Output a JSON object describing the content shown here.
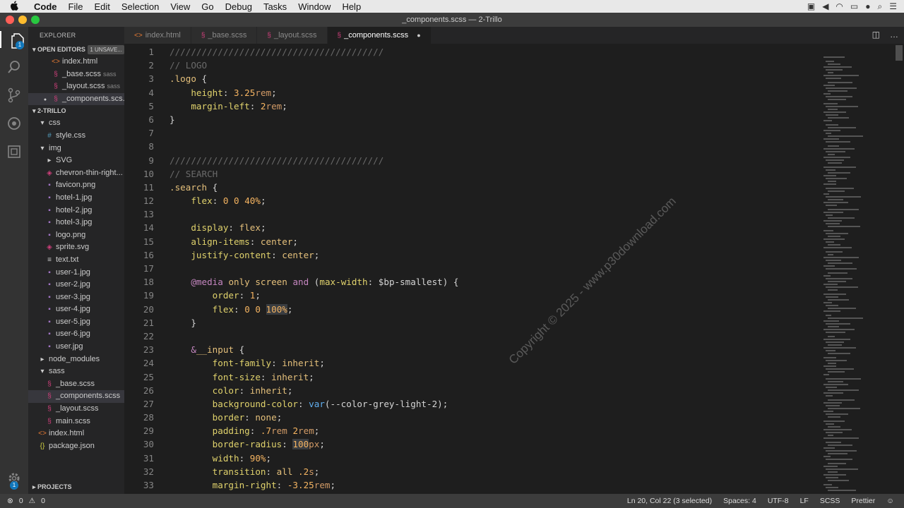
{
  "menubar": {
    "apple": "",
    "items": [
      "Code",
      "File",
      "Edit",
      "Selection",
      "View",
      "Go",
      "Debug",
      "Tasks",
      "Window",
      "Help"
    ]
  },
  "window": {
    "title": "_components.scss — 2-Trillo"
  },
  "activity": {
    "explorer_badge": "1",
    "settings_badge": "1"
  },
  "sidebar": {
    "title": "EXPLORER",
    "open_editors_label": "OPEN EDITORS",
    "unsaved_badge": "1 UNSAVE...",
    "open_editors": [
      {
        "name": "index.html",
        "sub": "",
        "icon": "<>"
      },
      {
        "name": "_base.scss",
        "sub": "sass",
        "icon": "S"
      },
      {
        "name": "_layout.scss",
        "sub": "sass",
        "icon": "S"
      },
      {
        "name": "_components.scs...",
        "sub": "",
        "icon": "S"
      }
    ],
    "project_label": "2-TRILLO",
    "tree": [
      {
        "name": "css",
        "indent": 1,
        "type": "folder-open"
      },
      {
        "name": "style.css",
        "indent": 2,
        "type": "css"
      },
      {
        "name": "img",
        "indent": 1,
        "type": "folder-open"
      },
      {
        "name": "SVG",
        "indent": 2,
        "type": "folder"
      },
      {
        "name": "chevron-thin-right...",
        "indent": 2,
        "type": "svg"
      },
      {
        "name": "favicon.png",
        "indent": 2,
        "type": "img"
      },
      {
        "name": "hotel-1.jpg",
        "indent": 2,
        "type": "img"
      },
      {
        "name": "hotel-2.jpg",
        "indent": 2,
        "type": "img"
      },
      {
        "name": "hotel-3.jpg",
        "indent": 2,
        "type": "img"
      },
      {
        "name": "logo.png",
        "indent": 2,
        "type": "img"
      },
      {
        "name": "sprite.svg",
        "indent": 2,
        "type": "svg"
      },
      {
        "name": "text.txt",
        "indent": 2,
        "type": "txt"
      },
      {
        "name": "user-1.jpg",
        "indent": 2,
        "type": "img"
      },
      {
        "name": "user-2.jpg",
        "indent": 2,
        "type": "img"
      },
      {
        "name": "user-3.jpg",
        "indent": 2,
        "type": "img"
      },
      {
        "name": "user-4.jpg",
        "indent": 2,
        "type": "img"
      },
      {
        "name": "user-5.jpg",
        "indent": 2,
        "type": "img"
      },
      {
        "name": "user-6.jpg",
        "indent": 2,
        "type": "img"
      },
      {
        "name": "user.jpg",
        "indent": 2,
        "type": "img"
      },
      {
        "name": "node_modules",
        "indent": 1,
        "type": "folder"
      },
      {
        "name": "sass",
        "indent": 1,
        "type": "folder-open"
      },
      {
        "name": "_base.scss",
        "indent": 2,
        "type": "scss"
      },
      {
        "name": "_components.scss",
        "indent": 2,
        "type": "scss",
        "selected": true
      },
      {
        "name": "_layout.scss",
        "indent": 2,
        "type": "scss"
      },
      {
        "name": "main.scss",
        "indent": 2,
        "type": "scss"
      },
      {
        "name": "index.html",
        "indent": 1,
        "type": "html"
      },
      {
        "name": "package.json",
        "indent": 1,
        "type": "json"
      }
    ],
    "projects_label": "PROJECTS"
  },
  "tabs": [
    {
      "label": "index.html",
      "icon": "<>",
      "active": false,
      "dirty": false
    },
    {
      "label": "_base.scss",
      "icon": "S",
      "active": false,
      "dirty": false
    },
    {
      "label": "_layout.scss",
      "icon": "S",
      "active": false,
      "dirty": false
    },
    {
      "label": "_components.scss",
      "icon": "S",
      "active": true,
      "dirty": true
    }
  ],
  "code": {
    "lines": [
      [
        [
          "c-com",
          "////////////////////////////////////////"
        ]
      ],
      [
        [
          "c-com",
          "// LOGO"
        ]
      ],
      [
        [
          "c-sel",
          ".logo"
        ],
        [
          "c-punc",
          " {"
        ]
      ],
      [
        [
          "c-punc",
          "    "
        ],
        [
          "c-prop",
          "height"
        ],
        [
          "c-punc",
          ": "
        ],
        [
          "c-num",
          "3.25"
        ],
        [
          "c-unit",
          "rem"
        ],
        [
          "c-punc",
          ";"
        ]
      ],
      [
        [
          "c-punc",
          "    "
        ],
        [
          "c-prop",
          "margin-left"
        ],
        [
          "c-punc",
          ": "
        ],
        [
          "c-num",
          "2"
        ],
        [
          "c-unit",
          "rem"
        ],
        [
          "c-punc",
          ";"
        ]
      ],
      [
        [
          "c-punc",
          "}"
        ]
      ],
      [],
      [],
      [
        [
          "c-com",
          "////////////////////////////////////////"
        ]
      ],
      [
        [
          "c-com",
          "// SEARCH"
        ]
      ],
      [
        [
          "c-sel",
          ".search"
        ],
        [
          "c-punc",
          " {"
        ]
      ],
      [
        [
          "c-punc",
          "    "
        ],
        [
          "c-prop",
          "flex"
        ],
        [
          "c-punc",
          ": "
        ],
        [
          "c-num",
          "0 0 40%"
        ],
        [
          "c-punc",
          ";"
        ]
      ],
      [],
      [
        [
          "c-punc",
          "    "
        ],
        [
          "c-prop",
          "display"
        ],
        [
          "c-punc",
          ": "
        ],
        [
          "c-kw",
          "flex"
        ],
        [
          "c-punc",
          ";"
        ]
      ],
      [
        [
          "c-punc",
          "    "
        ],
        [
          "c-prop",
          "align-items"
        ],
        [
          "c-punc",
          ": "
        ],
        [
          "c-kw",
          "center"
        ],
        [
          "c-punc",
          ";"
        ]
      ],
      [
        [
          "c-punc",
          "    "
        ],
        [
          "c-prop",
          "justify-content"
        ],
        [
          "c-punc",
          ": "
        ],
        [
          "c-kw",
          "center"
        ],
        [
          "c-punc",
          ";"
        ]
      ],
      [],
      [
        [
          "c-punc",
          "    "
        ],
        [
          "c-at",
          "@media"
        ],
        [
          "c-punc",
          " "
        ],
        [
          "c-kw",
          "only screen"
        ],
        [
          "c-punc",
          " "
        ],
        [
          "c-at",
          "and"
        ],
        [
          "c-punc",
          " ("
        ],
        [
          "c-prop",
          "max-width"
        ],
        [
          "c-punc",
          ": $bp-smallest) {"
        ]
      ],
      [
        [
          "c-punc",
          "        "
        ],
        [
          "c-prop",
          "order"
        ],
        [
          "c-punc",
          ": "
        ],
        [
          "c-num",
          "1"
        ],
        [
          "c-punc",
          ";"
        ]
      ],
      [
        [
          "c-punc",
          "        "
        ],
        [
          "c-prop",
          "flex"
        ],
        [
          "c-punc",
          ": "
        ],
        [
          "c-num",
          "0 0 "
        ],
        [
          "c-num hl",
          "100%"
        ],
        [
          "c-punc",
          ";"
        ]
      ],
      [
        [
          "c-punc",
          "    }"
        ]
      ],
      [],
      [
        [
          "c-punc",
          "    "
        ],
        [
          "c-at",
          "&"
        ],
        [
          "c-sel",
          "__input"
        ],
        [
          "c-punc",
          " {"
        ]
      ],
      [
        [
          "c-punc",
          "        "
        ],
        [
          "c-prop",
          "font-family"
        ],
        [
          "c-punc",
          ": "
        ],
        [
          "c-kw",
          "inherit"
        ],
        [
          "c-punc",
          ";"
        ]
      ],
      [
        [
          "c-punc",
          "        "
        ],
        [
          "c-prop",
          "font-size"
        ],
        [
          "c-punc",
          ": "
        ],
        [
          "c-kw",
          "inherit"
        ],
        [
          "c-punc",
          ";"
        ]
      ],
      [
        [
          "c-punc",
          "        "
        ],
        [
          "c-prop",
          "color"
        ],
        [
          "c-punc",
          ": "
        ],
        [
          "c-kw",
          "inherit"
        ],
        [
          "c-punc",
          ";"
        ]
      ],
      [
        [
          "c-punc",
          "        "
        ],
        [
          "c-prop",
          "background-color"
        ],
        [
          "c-punc",
          ": "
        ],
        [
          "c-fn",
          "var"
        ],
        [
          "c-punc",
          "(--color-grey-light-2);"
        ]
      ],
      [
        [
          "c-punc",
          "        "
        ],
        [
          "c-prop",
          "border"
        ],
        [
          "c-punc",
          ": "
        ],
        [
          "c-kw",
          "none"
        ],
        [
          "c-punc",
          ";"
        ]
      ],
      [
        [
          "c-punc",
          "        "
        ],
        [
          "c-prop",
          "padding"
        ],
        [
          "c-punc",
          ": "
        ],
        [
          "c-num",
          ".7"
        ],
        [
          "c-unit",
          "rem"
        ],
        [
          "c-punc",
          " "
        ],
        [
          "c-num",
          "2"
        ],
        [
          "c-unit",
          "rem"
        ],
        [
          "c-punc",
          ";"
        ]
      ],
      [
        [
          "c-punc",
          "        "
        ],
        [
          "c-prop",
          "border-radius"
        ],
        [
          "c-punc",
          ": "
        ],
        [
          "c-num hl",
          "100"
        ],
        [
          "c-unit",
          "px"
        ],
        [
          "c-punc",
          ";"
        ]
      ],
      [
        [
          "c-punc",
          "        "
        ],
        [
          "c-prop",
          "width"
        ],
        [
          "c-punc",
          ": "
        ],
        [
          "c-num",
          "90%"
        ],
        [
          "c-punc",
          ";"
        ]
      ],
      [
        [
          "c-punc",
          "        "
        ],
        [
          "c-prop",
          "transition"
        ],
        [
          "c-punc",
          ": "
        ],
        [
          "c-kw",
          "all"
        ],
        [
          "c-punc",
          " "
        ],
        [
          "c-num",
          ".2"
        ],
        [
          "c-unit",
          "s"
        ],
        [
          "c-punc",
          ";"
        ]
      ],
      [
        [
          "c-punc",
          "        "
        ],
        [
          "c-prop",
          "margin-right"
        ],
        [
          "c-punc",
          ": "
        ],
        [
          "c-num",
          "-3.25"
        ],
        [
          "c-unit",
          "rem"
        ],
        [
          "c-punc",
          ";"
        ]
      ]
    ]
  },
  "watermark": "Copyright © 2025 - www.p30download.com",
  "statusbar": {
    "errors": "0",
    "warnings": "0",
    "position": "Ln 20, Col 22 (3 selected)",
    "spaces": "Spaces: 4",
    "encoding": "UTF-8",
    "eol": "LF",
    "language": "SCSS",
    "formatter": "Prettier"
  },
  "colors": {
    "accent": "#1177bb",
    "scss_icon": "#cd3f7a",
    "html_icon": "#e37933"
  }
}
